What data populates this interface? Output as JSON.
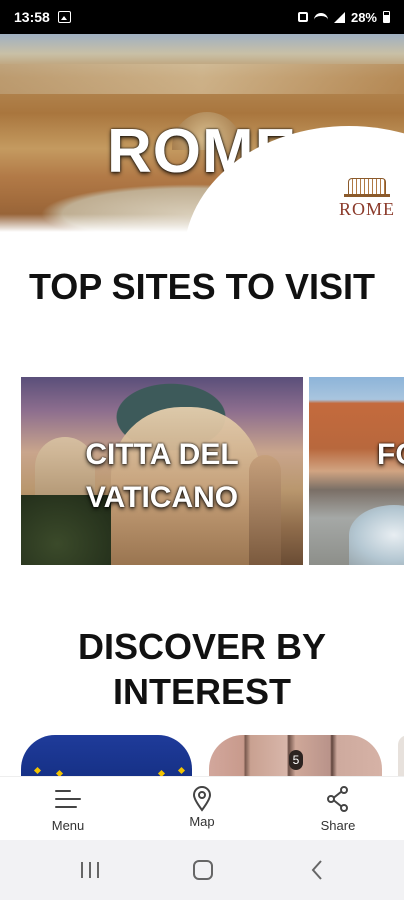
{
  "status_bar": {
    "time": "13:58",
    "battery": "28%",
    "icons": [
      "gallery-icon",
      "mute-icon",
      "wifi-icon",
      "signal-icon",
      "battery-icon"
    ]
  },
  "hero": {
    "title": "ROME",
    "logo_text": "ROME"
  },
  "sections": {
    "top_sites_heading": "TOP SITES TO VISIT",
    "discover_heading": "DISCOVER BY INTEREST"
  },
  "top_sites": [
    {
      "label": "CITTA DEL VATICANO"
    },
    {
      "label": "FO D"
    }
  ],
  "interest_cards": [
    {
      "image": "eu-flag-image"
    },
    {
      "image": "museum-columns-image",
      "badge": "5"
    },
    {
      "image": "partial-card"
    }
  ],
  "bottom_nav": {
    "menu_label": "Menu",
    "map_label": "Map",
    "share_label": "Share"
  },
  "system_nav": [
    "recents-icon",
    "home-icon",
    "back-icon"
  ],
  "colors": {
    "heading": "#111111",
    "eu_blue": "#1f3b9a",
    "logo_brown": "#8b3a2a"
  }
}
